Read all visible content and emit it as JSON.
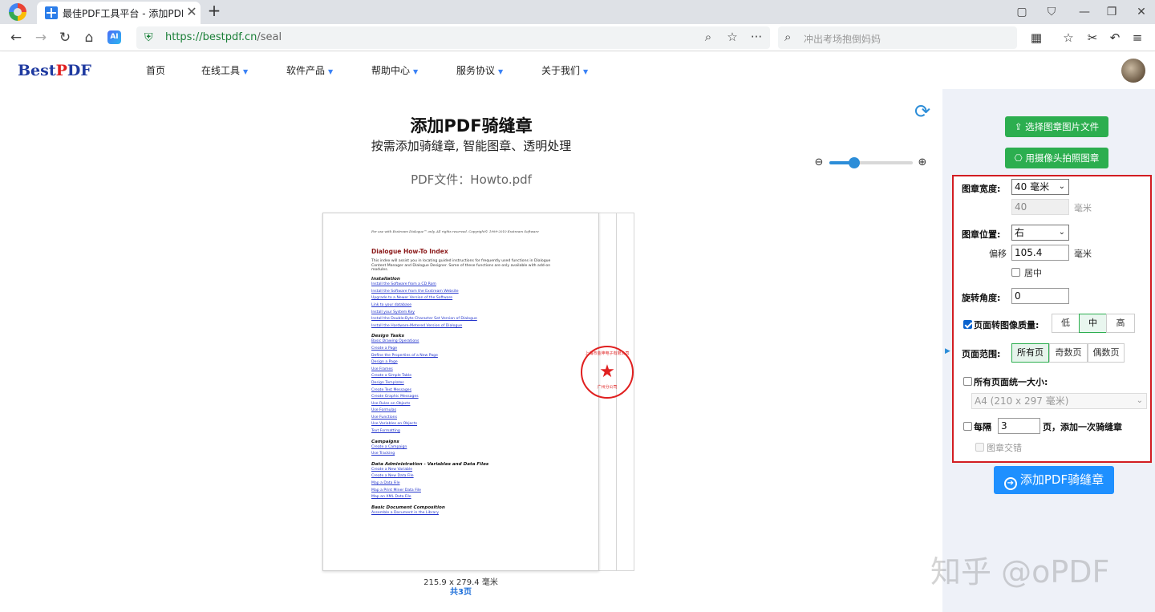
{
  "browser": {
    "tab_title": "最佳PDF工具平台 - 添加PDF骑",
    "tab_close": "✕",
    "new_tab": "+",
    "url_secure": "https://bestpdf.cn",
    "url_path": "/seal",
    "search_placeholder": "冲出考场抱倒妈妈",
    "icons": [
      "back-icon",
      "forward-icon",
      "reload-icon",
      "home-icon",
      "ai-icon",
      "shield-icon",
      "zoom-icon",
      "star-icon",
      "more-icon",
      "search-icon",
      "apps-icon",
      "collections-icon",
      "scissors-icon",
      "undo-icon",
      "menu-icon"
    ]
  },
  "site": {
    "logo_best": "Best",
    "logo_p": "P",
    "logo_df": "DF",
    "menu": [
      {
        "label": "首页",
        "has_dropdown": false
      },
      {
        "label": "在线工具",
        "has_dropdown": true
      },
      {
        "label": "软件产品",
        "has_dropdown": true
      },
      {
        "label": "帮助中心",
        "has_dropdown": true
      },
      {
        "label": "服务协议",
        "has_dropdown": true
      },
      {
        "label": "关于我们",
        "has_dropdown": true
      }
    ]
  },
  "main": {
    "title": "添加PDF骑缝章",
    "subtitle": "按需添加骑缝章, 智能图章、透明处理",
    "file_label": "PDF文件：Howto.pdf",
    "zoom_level": 0.3,
    "page_size": "215.9 x 279.4 毫米",
    "page_count": "共3页"
  },
  "document": {
    "header": "For use with Exstream Dialogue™ only. All rights reserved. Copyright© 1999-2010 Exstream Software",
    "title": "Dialogue How-To Index",
    "intro": "This index will assist you in locating guided instructions for frequently used functions in Dialogue Content Manager and Dialogue Designer. Some of these functions are only available with add-on modules.",
    "sections": [
      {
        "heading": "Installation",
        "links": [
          "Install the Software from a CD Rom",
          "Install the Software from the Exstream Website",
          "Upgrade to a Newer Version of the Software",
          "Link to your database",
          "Install your System Key",
          "Install the Double-Byte Character Set Version of Dialogue",
          "Install the Hardware-Metered Version of Dialogue"
        ]
      },
      {
        "heading": "Design Tasks",
        "links": [
          "Basic Drawing Operations",
          "Create a Page",
          "Define the Properties of a New Page",
          "Design a Page",
          "Use Frames",
          "Create a Simple Table",
          "Design Templates",
          "Create Text Messages",
          "Create Graphic Messages",
          "Use Rules on Objects",
          "Use Formulas",
          "Use Functions",
          "Use Variables on Objects",
          "Text Formatting"
        ]
      },
      {
        "heading": "Campaigns",
        "links": [
          "Create a Campaign",
          "Use Tracking"
        ]
      },
      {
        "heading": "Data Administration - Variables and Data Files",
        "links": [
          "Create a New Variable",
          "Create a New Data File",
          "Map a Data File",
          "Map a Print Miner Data File",
          "Map an XML Data File"
        ]
      },
      {
        "heading": "Basic Document Composition",
        "links": [
          "Assemble a Document in the Library"
        ]
      }
    ],
    "seal_top": "上海市金坤电子有限公司",
    "seal_bottom": "广州分公司",
    "seal_star": "★"
  },
  "sidebar": {
    "btn_select_image": "选择图章图片文件",
    "btn_camera": "用摄像头拍照图章",
    "width_label": "图章宽度:",
    "width_select": "40 毫米",
    "width_value": "40",
    "width_unit": "毫米",
    "position_label": "图章位置:",
    "position_select": "右",
    "offset_label": "偏移",
    "offset_value": "105.4",
    "offset_unit": "毫米",
    "center_label": "居中",
    "center_checked": false,
    "rotation_label": "旋转角度:",
    "rotation_value": "0",
    "quality_label": "页面转图像质量:",
    "quality_checked": true,
    "quality_options": [
      "低",
      "中",
      "高"
    ],
    "quality_selected": "中",
    "range_label": "页面范围:",
    "range_options": [
      "所有页",
      "奇数页",
      "偶数页"
    ],
    "range_selected": "所有页",
    "unify_label": "所有页面统一大小:",
    "unify_checked": false,
    "unify_select": "A4 (210 x 297 毫米)",
    "every_label": "每隔",
    "every_value": "3",
    "every_suffix": "页，添加一次骑缝章",
    "every_checked": false,
    "stagger_label": "图章交错",
    "submit": "添加PDF骑缝章"
  },
  "watermark": "知乎 @oPDF",
  "colors": {
    "accent_blue": "#1e90ff",
    "green": "#2cae4f",
    "panel_border": "#d21d22",
    "seal_red": "#e02020"
  }
}
